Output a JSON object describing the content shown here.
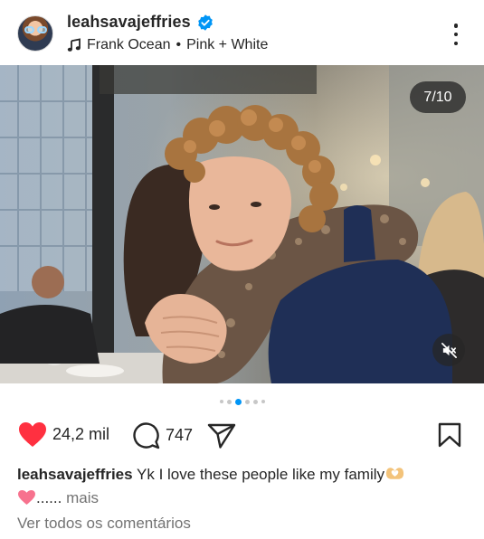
{
  "post": {
    "author": {
      "username": "leahsavajeffries",
      "verified": true
    },
    "music": {
      "artist": "Frank Ocean",
      "separator": "•",
      "track": "Pink + White"
    },
    "carousel": {
      "counter": "7/10",
      "current_index": 7,
      "total": 10,
      "dots_visible": 6
    },
    "stats": {
      "likes": "24,2 mil",
      "comments": "747"
    },
    "caption": {
      "username": "leahsavajeffries",
      "text": "Yk I love these people like my family",
      "ellipsis": "......",
      "more_label": "mais"
    },
    "view_all_comments": "Ver todos os comentários"
  },
  "icons": {
    "verified": "verified-badge-icon",
    "music": "music-note-icon",
    "more": "more-options-icon",
    "mute": "speaker-muted-icon",
    "like": "heart-icon",
    "comment": "comment-icon",
    "share": "paper-plane-icon",
    "save": "bookmark-icon"
  },
  "colors": {
    "text": "#262626",
    "muted": "#737373",
    "like_red": "#ff3040",
    "verified_blue": "#0095f6",
    "active_dot": "#0095f6",
    "inactive_dot": "#c7c7c7"
  }
}
